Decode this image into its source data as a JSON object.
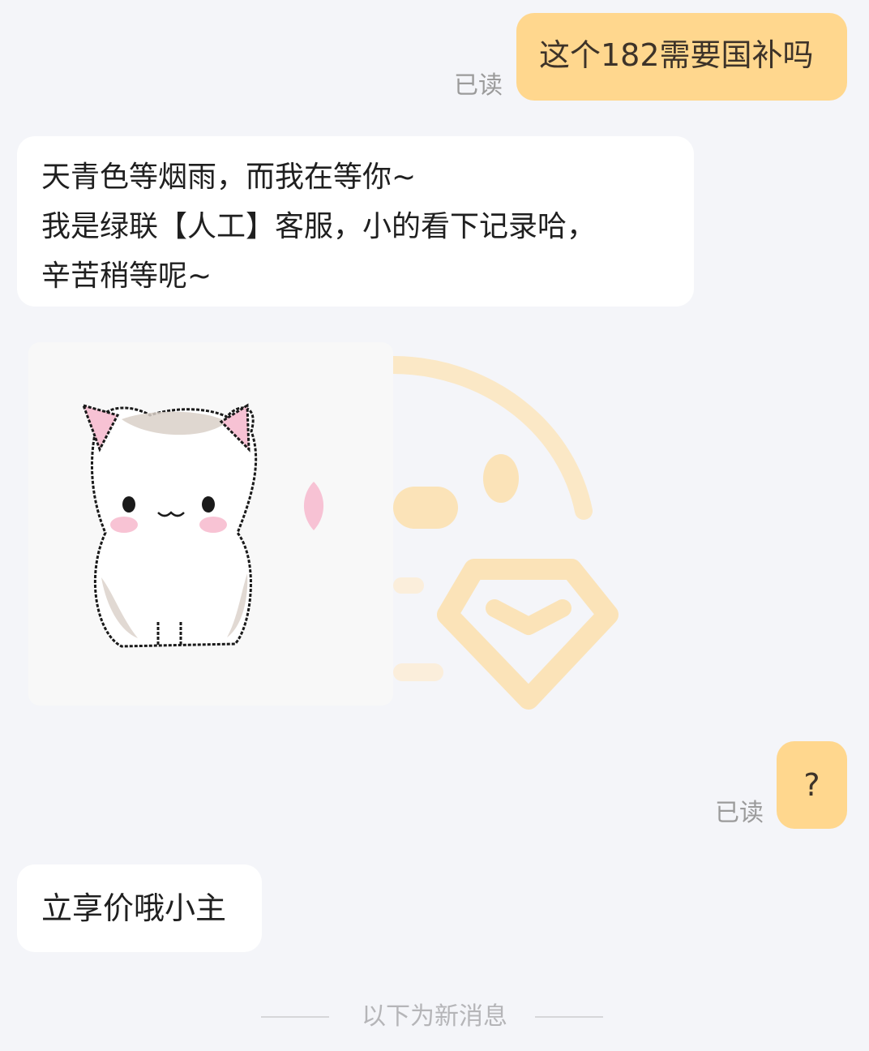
{
  "messages": {
    "m1": {
      "text": "这个182需要国补吗",
      "status": "已读"
    },
    "m2": {
      "lines": [
        "天青色等烟雨，而我在等你~",
        "我是绿联【人工】客服，小的看下记录哈，",
        "辛苦稍等呢~"
      ]
    },
    "m3": {
      "sticker": "pixel-cat-sticker"
    },
    "m4": {
      "text": "?",
      "status": "已读"
    },
    "m5": {
      "text": "立享价哦小主"
    }
  },
  "divider": {
    "text": "以下为新消息"
  },
  "colors": {
    "background": "#f4f5f9",
    "outgoing_bubble": "#ffd78e",
    "incoming_bubble": "#ffffff",
    "read_status": "#9b9b9b",
    "watermark": "#fbe3b8"
  },
  "icons": [
    "brand-watermark-icon",
    "cat-sticker-icon"
  ]
}
